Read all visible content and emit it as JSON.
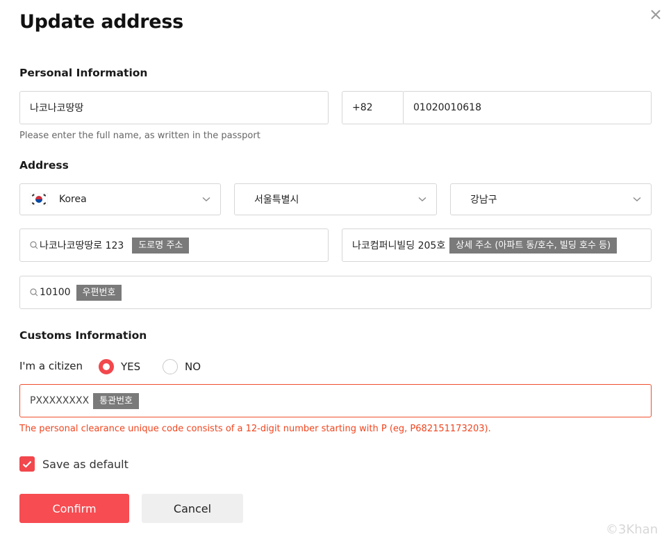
{
  "dialog": {
    "title": "Update address"
  },
  "personal": {
    "section_label": "Personal Information",
    "name_value": "나코나코땅땅",
    "phone_code": "+82",
    "phone_number": "01020010618",
    "helper": "Please enter the full name, as written in the passport"
  },
  "address": {
    "section_label": "Address",
    "country": "Korea",
    "city": "서울특별시",
    "district": "강남구",
    "street_value": "나코나코땅땅로 123",
    "street_tag": "도로명 주소",
    "detail_value": "나코컴퍼니빌딩 205호",
    "detail_tag": "상세 주소 (아파트 동/호수, 빌딩 호수 등)",
    "postal_value": "10100",
    "postal_tag": "우편번호"
  },
  "customs": {
    "section_label": "Customs Information",
    "citizen_label": "I'm a citizen",
    "yes_label": "YES",
    "no_label": "NO",
    "selected": "YES",
    "code_value": "PXXXXXXXX",
    "code_tag": "통관번호",
    "error": "The personal clearance unique code consists of a 12-digit number starting with P (eg, P682151173203)."
  },
  "save_default": {
    "label": "Save as default",
    "checked": true
  },
  "actions": {
    "confirm_label": "Confirm",
    "cancel_label": "Cancel"
  },
  "watermark": "©3Khan",
  "colors": {
    "accent": "#f64c52",
    "error": "#f0451f",
    "border": "#d6d6d6"
  },
  "icons": {
    "close": "close-icon",
    "chevron": "chevron-down-icon",
    "search": "search-icon",
    "flag": "korea-flag-icon",
    "check": "checkmark-icon"
  }
}
